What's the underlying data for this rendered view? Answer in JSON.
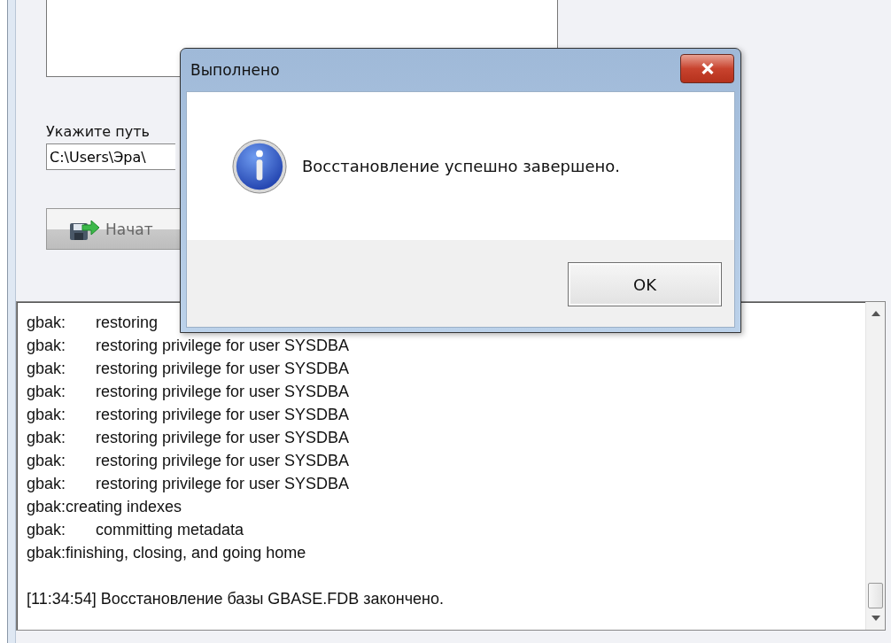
{
  "main_window": {
    "path_label": "Укажите путь",
    "path_field": {
      "value": "C:\\Users\\Эра\\"
    },
    "start_button": {
      "label": "Начат",
      "disabled": true
    },
    "log": {
      "lines": [
        "gbak:\trestoring",
        "gbak:\trestoring privilege for user SYSDBA",
        "gbak:\trestoring privilege for user SYSDBA",
        "gbak:\trestoring privilege for user SYSDBA",
        "gbak:\trestoring privilege for user SYSDBA",
        "gbak:\trestoring privilege for user SYSDBA",
        "gbak:\trestoring privilege for user SYSDBA",
        "gbak:\trestoring privilege for user SYSDBA",
        "gbak:creating indexes",
        "gbak:\tcommitting metadata",
        "gbak:finishing, closing, and going home"
      ],
      "summary": "[11:34:54] Восстановление базы GBASE.FDB закончено."
    }
  },
  "dialog": {
    "title": "Выполнено",
    "message": "Восстановление успешно завершено.",
    "buttons": [
      "OK"
    ]
  }
}
